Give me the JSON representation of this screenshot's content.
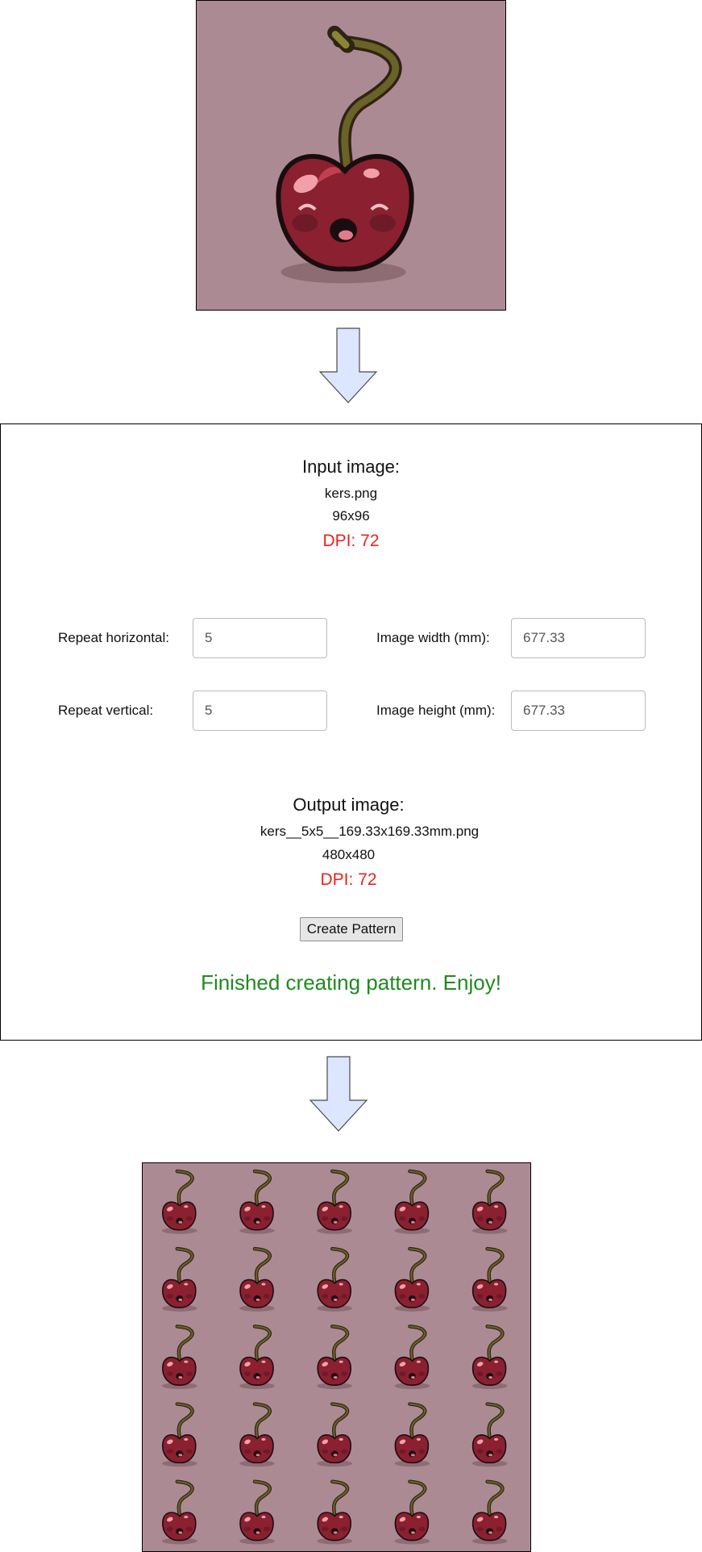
{
  "input_section": {
    "title": "Input image:",
    "filename": "kers.png",
    "dimensions": "96x96",
    "dpi": "DPI: 72"
  },
  "form": {
    "repeat_horizontal_label": "Repeat horizontal:",
    "repeat_horizontal_value": "5",
    "repeat_vertical_label": "Repeat vertical:",
    "repeat_vertical_value": "5",
    "image_width_label": "Image width (mm):",
    "image_width_value": "677.33",
    "image_height_label": "Image height (mm):",
    "image_height_value": "677.33"
  },
  "output_section": {
    "title": "Output image:",
    "filename": "kers__5x5__169.33x169.33mm.png",
    "dimensions": "480x480",
    "dpi": "DPI: 72"
  },
  "create_button_label": "Create Pattern",
  "status_message": "Finished creating pattern. Enjoy!",
  "colors": {
    "preview_background": "#ac8a94",
    "dpi_text": "#e8231f",
    "status_text": "#1f8a1f",
    "arrow_fill": "#dce6ff",
    "cherry_body": "#8a2030",
    "cherry_highlight": "#f0a0a8"
  },
  "pattern": {
    "columns": 5,
    "rows": 5
  }
}
